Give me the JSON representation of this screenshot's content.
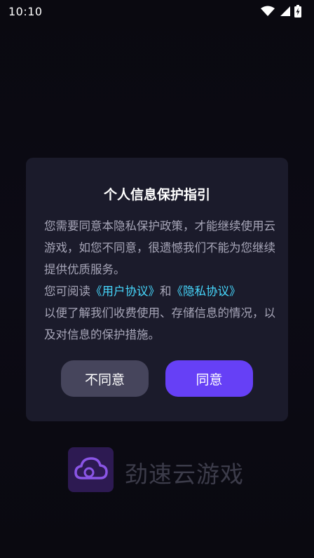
{
  "status_bar": {
    "time": "10:10",
    "icons": [
      "wifi-icon",
      "signal-icon",
      "battery-charging-icon"
    ]
  },
  "dialog": {
    "title": "个人信息保护指引",
    "paragraph1": "您需要同意本隐私保护政策，才能继续使用云游戏，如您不同意，很遗憾我们不能为您继续提供优质服务。",
    "read_prefix": "您可阅读",
    "user_agreement_link": "《用户协议》",
    "and_text": "和",
    "privacy_link": "《隐私协议》",
    "paragraph2_rest": "以便了解我们收费使用、存储信息的情况，以及对信息的保护措施。",
    "disagree_label": "不同意",
    "agree_label": "同意"
  },
  "brand": {
    "logo_icon": "cloud-icon",
    "name": "劲速云游戏"
  },
  "colors": {
    "background": "#0b0a12",
    "dialog_bg": "#1b1b2b",
    "link": "#47d9ff",
    "agree_button": "#6640f6",
    "disagree_button": "#46455c",
    "logo_bg": "#2d1a52",
    "logo_stroke": "#8a55e6",
    "brand_text": "#3c3c4a"
  }
}
